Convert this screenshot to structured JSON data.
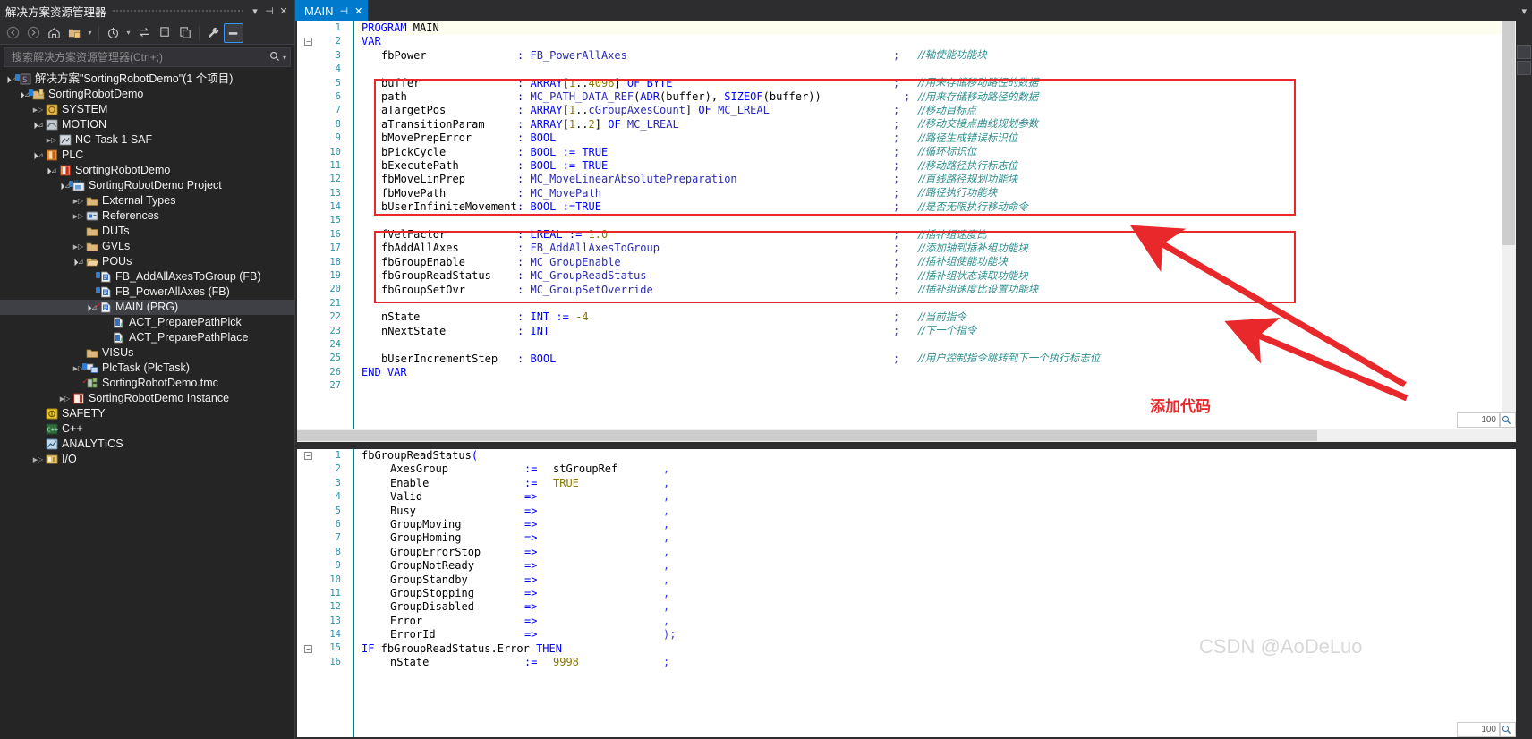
{
  "solution_explorer": {
    "title": "解决方案资源管理器",
    "title_buttons": [
      "chevron-down",
      "pin",
      "close"
    ],
    "toolbar": [
      {
        "name": "back-icon",
        "glyph": "←"
      },
      {
        "name": "forward-icon",
        "glyph": "→"
      },
      {
        "name": "home-icon",
        "glyph": "⌂"
      },
      {
        "name": "new-folder-icon",
        "glyph": "▣"
      },
      {
        "name": "pending-changes-icon",
        "glyph": "◷"
      },
      {
        "name": "sync-icon",
        "glyph": "⇄"
      },
      {
        "name": "collapse-all-icon",
        "glyph": "⊟"
      },
      {
        "name": "properties-icon",
        "glyph": "⧉"
      },
      {
        "name": "wrench-icon",
        "glyph": "🔧"
      },
      {
        "name": "show-all-files-icon",
        "glyph": "▬"
      }
    ],
    "search_placeholder": "搜索解决方案资源管理器(Ctrl+;)",
    "search_value": "",
    "tree": [
      {
        "label": "解决方案\"SortingRobotDemo\"(1 个项目)",
        "depth": 0,
        "twist": "expanded",
        "icon": "solution-icon",
        "selected": false
      },
      {
        "label": "SortingRobotDemo",
        "depth": 1,
        "twist": "expanded",
        "icon": "project-icon",
        "selected": false
      },
      {
        "label": "SYSTEM",
        "depth": 2,
        "twist": "collapsed",
        "icon": "system-icon",
        "selected": false
      },
      {
        "label": "MOTION",
        "depth": 2,
        "twist": "expanded",
        "icon": "motion-icon",
        "selected": false
      },
      {
        "label": "NC-Task 1 SAF",
        "depth": 3,
        "twist": "collapsed",
        "icon": "nctask-icon",
        "selected": false
      },
      {
        "label": "PLC",
        "depth": 2,
        "twist": "expanded",
        "icon": "plc-icon",
        "selected": false
      },
      {
        "label": "SortingRobotDemo",
        "depth": 3,
        "twist": "expanded",
        "icon": "plc-project-icon",
        "selected": false
      },
      {
        "label": "SortingRobotDemo Project",
        "depth": 4,
        "twist": "expanded",
        "icon": "plc-proj-icon",
        "selected": false
      },
      {
        "label": "External Types",
        "depth": 5,
        "twist": "collapsed",
        "icon": "folder-icon",
        "selected": false
      },
      {
        "label": "References",
        "depth": 5,
        "twist": "collapsed",
        "icon": "references-icon",
        "selected": false
      },
      {
        "label": "DUTs",
        "depth": 5,
        "twist": "none",
        "icon": "folder-icon",
        "selected": false
      },
      {
        "label": "GVLs",
        "depth": 5,
        "twist": "collapsed",
        "icon": "folder-icon",
        "selected": false
      },
      {
        "label": "POUs",
        "depth": 5,
        "twist": "expanded",
        "icon": "folder-open-icon",
        "selected": false
      },
      {
        "label": "FB_AddAllAxesToGroup (FB)",
        "depth": 6,
        "twist": "none",
        "icon": "pou-icon",
        "selected": false
      },
      {
        "label": "FB_PowerAllAxes (FB)",
        "depth": 6,
        "twist": "none",
        "icon": "pou-icon",
        "selected": false
      },
      {
        "label": "MAIN (PRG)",
        "depth": 6,
        "twist": "expanded",
        "icon": "pou-modified-icon",
        "selected": true
      },
      {
        "label": "ACT_PreparePathPick",
        "depth": 7,
        "twist": "none",
        "icon": "action-icon",
        "selected": false
      },
      {
        "label": "ACT_PreparePathPlace",
        "depth": 7,
        "twist": "none",
        "icon": "action-icon",
        "selected": false
      },
      {
        "label": "VISUs",
        "depth": 5,
        "twist": "none",
        "icon": "folder-icon",
        "selected": false
      },
      {
        "label": "PlcTask (PlcTask)",
        "depth": 5,
        "twist": "collapsed",
        "icon": "task-icon",
        "selected": false
      },
      {
        "label": "SortingRobotDemo.tmc",
        "depth": 5,
        "twist": "none",
        "icon": "tmc-icon",
        "selected": false
      },
      {
        "label": "SortingRobotDemo Instance",
        "depth": 4,
        "twist": "collapsed",
        "icon": "instance-icon",
        "selected": false
      },
      {
        "label": "SAFETY",
        "depth": 2,
        "twist": "none",
        "icon": "safety-icon",
        "selected": false
      },
      {
        "label": "C++",
        "depth": 2,
        "twist": "none",
        "icon": "cpp-icon",
        "selected": false
      },
      {
        "label": "ANALYTICS",
        "depth": 2,
        "twist": "none",
        "icon": "analytics-icon",
        "selected": false
      },
      {
        "label": "I/O",
        "depth": 2,
        "twist": "collapsed",
        "icon": "io-icon",
        "selected": false
      }
    ]
  },
  "tabstrip": {
    "tabs": [
      {
        "label": "MAIN",
        "active": true,
        "pin": "⊣",
        "close": "✕"
      }
    ]
  },
  "top_editor": {
    "zoom_level": "100",
    "lines": [
      {
        "n": 1,
        "fold": "none",
        "current": true,
        "name": "PROGRAM MAIN",
        "kw": "PROGRAM",
        "rest": " MAIN"
      },
      {
        "n": 2,
        "fold": "minus",
        "name": "VAR"
      },
      {
        "n": 3,
        "name": "fbPower",
        "type": ": FB_PowerAllAxes",
        "comment": "//轴使能功能块"
      },
      {
        "n": 4,
        "name": ""
      },
      {
        "n": 5,
        "name": "buffer",
        "type": ": ARRAY[1..4096] OF BYTE",
        "comment": "//用来存储移动路径的数据"
      },
      {
        "n": 6,
        "name": "path",
        "type": ": MC_PATH_DATA_REF(ADR(buffer), SIZEOF(buffer))",
        "comment": "//用来存储移动路径的数据"
      },
      {
        "n": 7,
        "name": "aTargetPos",
        "type": ": ARRAY[1..cGroupAxesCount] OF MC_LREAL",
        "comment": "//移动目标点"
      },
      {
        "n": 8,
        "name": "aTransitionParam",
        "type": ": ARRAY[1..2] OF MC_LREAL",
        "comment": "//移动交接点曲线规划参数"
      },
      {
        "n": 9,
        "name": "bMovePrepError",
        "type": ": BOOL",
        "comment": "//路径生成错误标识位"
      },
      {
        "n": 10,
        "name": "bPickCycle",
        "type": ": BOOL := TRUE",
        "comment": "//循环标识位"
      },
      {
        "n": 11,
        "name": "bExecutePath",
        "type": ": BOOL := TRUE",
        "comment": "//移动路径执行标志位"
      },
      {
        "n": 12,
        "name": "fbMoveLinPrep",
        "type": ": MC_MoveLinearAbsolutePreparation",
        "comment": "//直线路径规划功能块"
      },
      {
        "n": 13,
        "name": "fbMovePath",
        "type": ": MC_MovePath",
        "comment": "//路径执行功能块"
      },
      {
        "n": 14,
        "name": "bUserInfiniteMovement",
        "type": ": BOOL :=TRUE",
        "comment": "//是否无限执行移动命令"
      },
      {
        "n": 15,
        "name": ""
      },
      {
        "n": 16,
        "name": "fVelFactor",
        "type": ": LREAL := 1.0",
        "comment": "//插补组速度比"
      },
      {
        "n": 17,
        "name": "fbAddAllAxes",
        "type": ": FB_AddAllAxesToGroup",
        "comment": "//添加轴到插补组功能块"
      },
      {
        "n": 18,
        "name": "fbGroupEnable",
        "type": ": MC_GroupEnable",
        "comment": "//插补组使能功能块"
      },
      {
        "n": 19,
        "name": "fbGroupReadStatus",
        "type": ": MC_GroupReadStatus",
        "comment": "//插补组状态读取功能块"
      },
      {
        "n": 20,
        "name": "fbGroupSetOvr",
        "type": ": MC_GroupSetOverride",
        "comment": "//插补组速度比设置功能块"
      },
      {
        "n": 21,
        "name": ""
      },
      {
        "n": 22,
        "name": "nState",
        "type": ": INT := -4",
        "comment": "//当前指令"
      },
      {
        "n": 23,
        "name": "nNextState",
        "type": ": INT",
        "comment": "//下一个指令"
      },
      {
        "n": 24,
        "name": ""
      },
      {
        "n": 25,
        "name": "bUserIncrementStep",
        "type": ": BOOL",
        "comment": "//用户控制指令跳转到下一个执行标志位"
      },
      {
        "n": 26,
        "name": "END_VAR"
      },
      {
        "n": 27,
        "name": ""
      }
    ]
  },
  "bottom_editor": {
    "zoom_level": "100",
    "lines": [
      {
        "n": 1,
        "fold": "minus",
        "text": "fbGroupReadStatus("
      },
      {
        "n": 2,
        "param": "AxesGroup",
        "op": ":=",
        "value": "stGroupRef",
        "tail": ","
      },
      {
        "n": 3,
        "param": "Enable",
        "op": ":=",
        "value": "TRUE",
        "tail": ","
      },
      {
        "n": 4,
        "param": "Valid",
        "op": "=>",
        "value": "",
        "tail": ","
      },
      {
        "n": 5,
        "param": "Busy",
        "op": "=>",
        "value": "",
        "tail": ","
      },
      {
        "n": 6,
        "param": "GroupMoving",
        "op": "=>",
        "value": "",
        "tail": ","
      },
      {
        "n": 7,
        "param": "GroupHoming",
        "op": "=>",
        "value": "",
        "tail": ","
      },
      {
        "n": 8,
        "param": "GroupErrorStop",
        "op": "=>",
        "value": "",
        "tail": ","
      },
      {
        "n": 9,
        "param": "GroupNotReady",
        "op": "=>",
        "value": "",
        "tail": ","
      },
      {
        "n": 10,
        "param": "GroupStandby",
        "op": "=>",
        "value": "",
        "tail": ","
      },
      {
        "n": 11,
        "param": "GroupStopping",
        "op": "=>",
        "value": "",
        "tail": ","
      },
      {
        "n": 12,
        "param": "GroupDisabled",
        "op": "=>",
        "value": "",
        "tail": ","
      },
      {
        "n": 13,
        "param": "Error",
        "op": "=>",
        "value": "",
        "tail": ","
      },
      {
        "n": 14,
        "param": "ErrorId",
        "op": "=>",
        "value": "",
        "tail": ");"
      },
      {
        "n": 15,
        "fold": "minus",
        "text": "IF fbGroupReadStatus.Error THEN",
        "kw1": "IF",
        "mid": " fbGroupReadStatus.Error ",
        "kw2": "THEN"
      },
      {
        "n": 16,
        "param": "nState",
        "op": ":=",
        "value": "9998",
        "tail": ";"
      }
    ]
  },
  "annotations": {
    "label": "添加代码",
    "color": "#e8282b",
    "boxes": [
      {
        "name": "highlight-box-1"
      },
      {
        "name": "highlight-box-2"
      }
    ],
    "arrows": [
      {
        "name": "arrow-to-box-1"
      },
      {
        "name": "arrow-to-box-2"
      }
    ]
  },
  "watermark": {
    "text": "CSDN @AoDeLuo"
  }
}
